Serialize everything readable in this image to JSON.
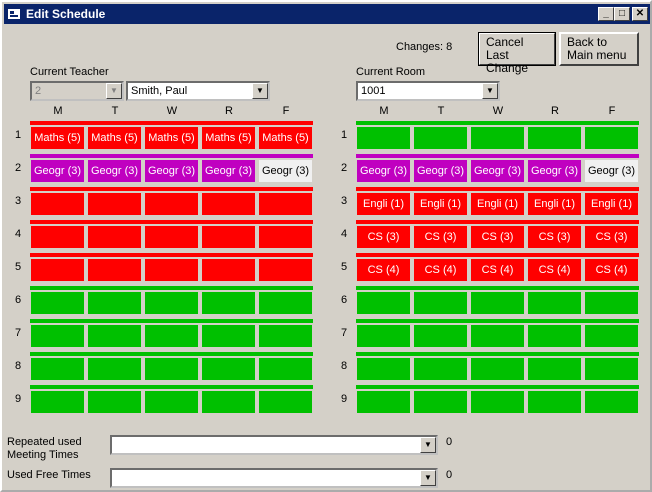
{
  "window": {
    "title": "Edit Schedule",
    "minimize": "_",
    "maximize": "□",
    "close": "✕"
  },
  "changes_label": "Changes: 8",
  "buttons": {
    "cancel_last_change": "Cancel Last Change",
    "back_to_main": "Back to Main menu"
  },
  "current_teacher": {
    "label": "Current Teacher",
    "id_value": "2",
    "name_value": "Smith, Paul"
  },
  "current_room": {
    "label": "Current Room",
    "value": "1001"
  },
  "days": [
    "M",
    "T",
    "W",
    "R",
    "F"
  ],
  "periods": [
    "1",
    "2",
    "3",
    "4",
    "5",
    "6",
    "7",
    "8",
    "9"
  ],
  "colors": {
    "red": "#ff0000",
    "green": "#00c000",
    "purple": "#c000c0",
    "white": "#f0f0f0"
  },
  "teacher_stripes": [
    "red",
    "purple",
    "red",
    "red",
    "red",
    "green",
    "green",
    "green",
    "green"
  ],
  "room_stripes": [
    "green",
    "purple",
    "red",
    "red",
    "red",
    "green",
    "green",
    "green",
    "green"
  ],
  "teacher_grid": [
    [
      {
        "t": "Maths (5)",
        "c": "red"
      },
      {
        "t": "Maths (5)",
        "c": "red"
      },
      {
        "t": "Maths (5)",
        "c": "red"
      },
      {
        "t": "Maths (5)",
        "c": "red"
      },
      {
        "t": "Maths (5)",
        "c": "red"
      }
    ],
    [
      {
        "t": "Geogr (3)",
        "c": "purple"
      },
      {
        "t": "Geogr (3)",
        "c": "purple"
      },
      {
        "t": "Geogr (3)",
        "c": "purple"
      },
      {
        "t": "Geogr (3)",
        "c": "purple"
      },
      {
        "t": "Geogr (3)",
        "c": "white"
      }
    ],
    [
      {
        "t": "",
        "c": "red"
      },
      {
        "t": "",
        "c": "red"
      },
      {
        "t": "",
        "c": "red"
      },
      {
        "t": "",
        "c": "red"
      },
      {
        "t": "",
        "c": "red"
      }
    ],
    [
      {
        "t": "",
        "c": "red"
      },
      {
        "t": "",
        "c": "red"
      },
      {
        "t": "",
        "c": "red"
      },
      {
        "t": "",
        "c": "red"
      },
      {
        "t": "",
        "c": "red"
      }
    ],
    [
      {
        "t": "",
        "c": "red"
      },
      {
        "t": "",
        "c": "red"
      },
      {
        "t": "",
        "c": "red"
      },
      {
        "t": "",
        "c": "red"
      },
      {
        "t": "",
        "c": "red"
      }
    ],
    [
      {
        "t": "",
        "c": "green"
      },
      {
        "t": "",
        "c": "green"
      },
      {
        "t": "",
        "c": "green"
      },
      {
        "t": "",
        "c": "green"
      },
      {
        "t": "",
        "c": "green"
      }
    ],
    [
      {
        "t": "",
        "c": "green"
      },
      {
        "t": "",
        "c": "green"
      },
      {
        "t": "",
        "c": "green"
      },
      {
        "t": "",
        "c": "green"
      },
      {
        "t": "",
        "c": "green"
      }
    ],
    [
      {
        "t": "",
        "c": "green"
      },
      {
        "t": "",
        "c": "green"
      },
      {
        "t": "",
        "c": "green"
      },
      {
        "t": "",
        "c": "green"
      },
      {
        "t": "",
        "c": "green"
      }
    ],
    [
      {
        "t": "",
        "c": "green"
      },
      {
        "t": "",
        "c": "green"
      },
      {
        "t": "",
        "c": "green"
      },
      {
        "t": "",
        "c": "green"
      },
      {
        "t": "",
        "c": "green"
      }
    ]
  ],
  "room_grid": [
    [
      {
        "t": "",
        "c": "green"
      },
      {
        "t": "",
        "c": "green"
      },
      {
        "t": "",
        "c": "green"
      },
      {
        "t": "",
        "c": "green"
      },
      {
        "t": "",
        "c": "green"
      }
    ],
    [
      {
        "t": "Geogr (3)",
        "c": "purple"
      },
      {
        "t": "Geogr (3)",
        "c": "purple"
      },
      {
        "t": "Geogr (3)",
        "c": "purple"
      },
      {
        "t": "Geogr (3)",
        "c": "purple"
      },
      {
        "t": "Geogr (3)",
        "c": "white"
      }
    ],
    [
      {
        "t": "Engli (1)",
        "c": "red"
      },
      {
        "t": "Engli (1)",
        "c": "red"
      },
      {
        "t": "Engli (1)",
        "c": "red"
      },
      {
        "t": "Engli (1)",
        "c": "red"
      },
      {
        "t": "Engli (1)",
        "c": "red"
      }
    ],
    [
      {
        "t": "CS (3)",
        "c": "red"
      },
      {
        "t": "CS (3)",
        "c": "red"
      },
      {
        "t": "CS (3)",
        "c": "red"
      },
      {
        "t": "CS (3)",
        "c": "red"
      },
      {
        "t": "CS (3)",
        "c": "red"
      }
    ],
    [
      {
        "t": "CS (4)",
        "c": "red"
      },
      {
        "t": "CS (4)",
        "c": "red"
      },
      {
        "t": "CS (4)",
        "c": "red"
      },
      {
        "t": "CS (4)",
        "c": "red"
      },
      {
        "t": "CS (4)",
        "c": "red"
      }
    ],
    [
      {
        "t": "",
        "c": "green"
      },
      {
        "t": "",
        "c": "green"
      },
      {
        "t": "",
        "c": "green"
      },
      {
        "t": "",
        "c": "green"
      },
      {
        "t": "",
        "c": "green"
      }
    ],
    [
      {
        "t": "",
        "c": "green"
      },
      {
        "t": "",
        "c": "green"
      },
      {
        "t": "",
        "c": "green"
      },
      {
        "t": "",
        "c": "green"
      },
      {
        "t": "",
        "c": "green"
      }
    ],
    [
      {
        "t": "",
        "c": "green"
      },
      {
        "t": "",
        "c": "green"
      },
      {
        "t": "",
        "c": "green"
      },
      {
        "t": "",
        "c": "green"
      },
      {
        "t": "",
        "c": "green"
      }
    ],
    [
      {
        "t": "",
        "c": "green"
      },
      {
        "t": "",
        "c": "green"
      },
      {
        "t": "",
        "c": "green"
      },
      {
        "t": "",
        "c": "green"
      },
      {
        "t": "",
        "c": "green"
      }
    ]
  ],
  "repeated_used": {
    "label_line1": "Repeated used",
    "label_line2": "Meeting Times",
    "value": "",
    "count": "0"
  },
  "used_free": {
    "label": "Used Free Times",
    "value": "",
    "count": "0"
  }
}
